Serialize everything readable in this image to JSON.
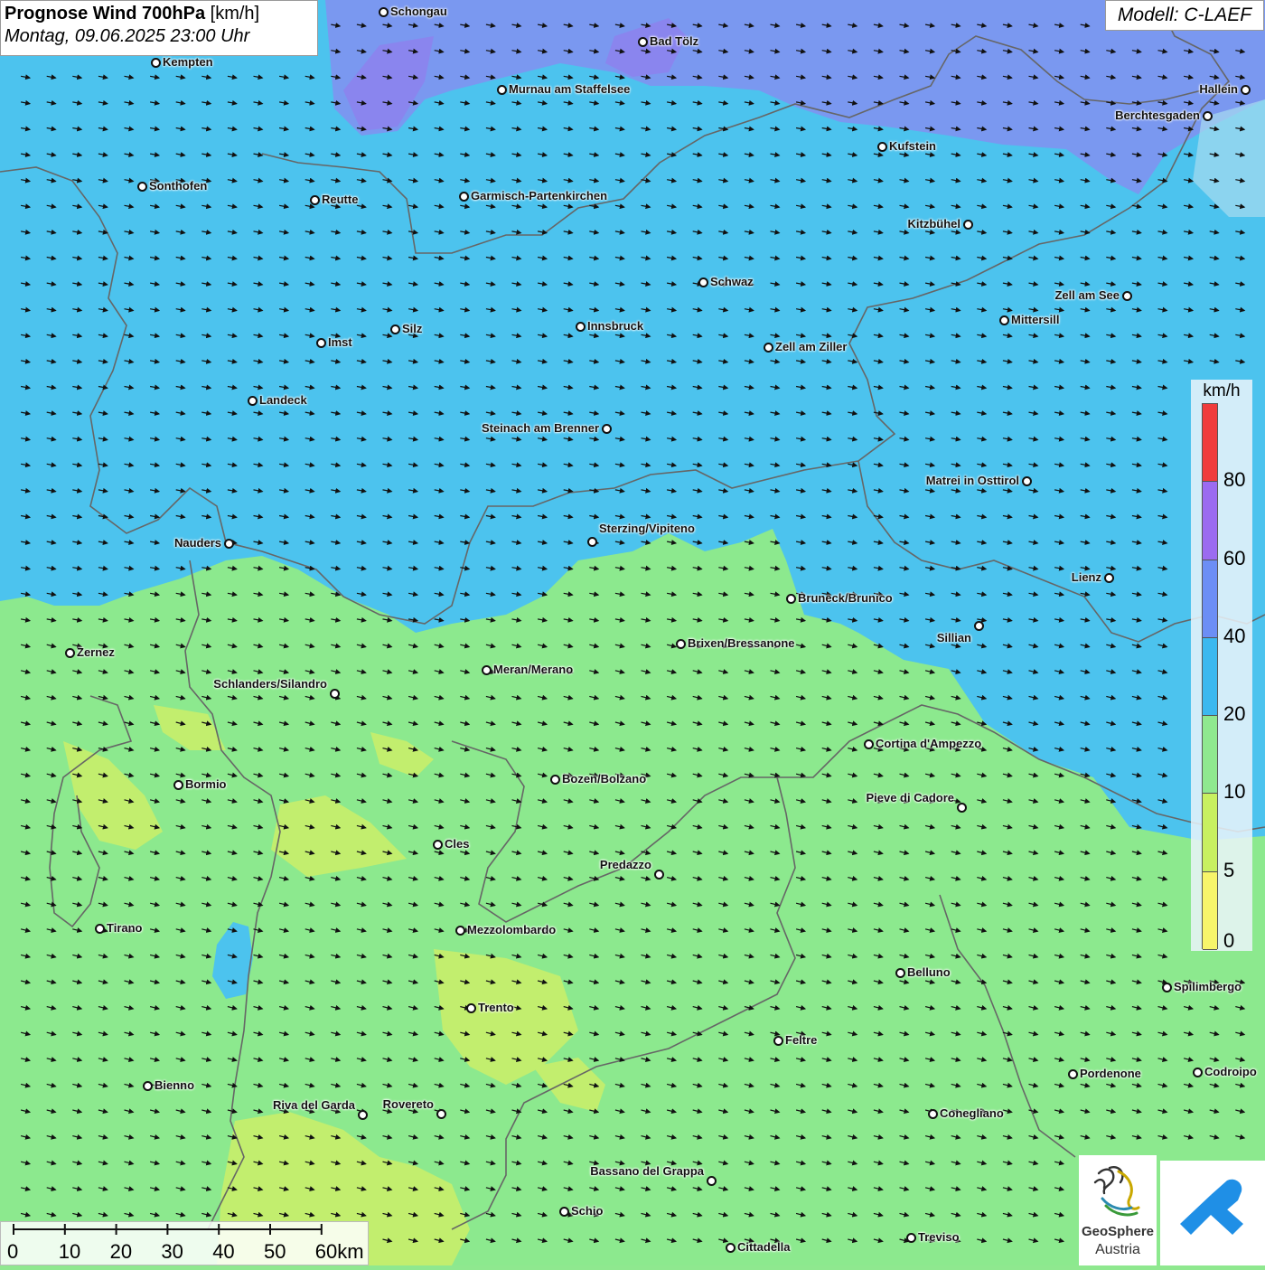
{
  "title": {
    "bold": "Prognose Wind 700hPa",
    "unit": " [km/h]",
    "date": "Montag, 09.06.2025 23:00 Uhr"
  },
  "model": "Modell: C-LAEF",
  "legend": {
    "unit": "km/h",
    "ticks": [
      "80",
      "60",
      "40",
      "20",
      "10",
      "5",
      "0"
    ],
    "colors": [
      "#f03c3c",
      "#9b6bf0",
      "#6c8ef5",
      "#3cb8ef",
      "#8fe88f",
      "#c8f060",
      "#f7f56a"
    ]
  },
  "scale": {
    "labels": [
      "0",
      "10",
      "20",
      "30",
      "40",
      "50",
      "60km"
    ]
  },
  "logo": {
    "line1": "GeoSphere",
    "line2": "Austria"
  },
  "wind_direction": "west-northwest to east-southeast",
  "cities": [
    {
      "name": "Schongau"
    },
    {
      "name": "Bad Tölz"
    },
    {
      "name": "Kempten"
    },
    {
      "name": "Murnau am Staffelsee"
    },
    {
      "name": "Hallein"
    },
    {
      "name": "Berchtesgaden"
    },
    {
      "name": "Kufstein"
    },
    {
      "name": "Sonthofen"
    },
    {
      "name": "Reutte"
    },
    {
      "name": "Garmisch-Partenkirchen"
    },
    {
      "name": "Kitzbühel"
    },
    {
      "name": "Schwaz"
    },
    {
      "name": "Zell am See"
    },
    {
      "name": "Mittersill"
    },
    {
      "name": "Innsbruck"
    },
    {
      "name": "Silz"
    },
    {
      "name": "Imst"
    },
    {
      "name": "Zell am Ziller"
    },
    {
      "name": "Landeck"
    },
    {
      "name": "Steinach am Brenner"
    },
    {
      "name": "Matrei in Osttirol"
    },
    {
      "name": "Nauders"
    },
    {
      "name": "Sterzing/Vipiteno"
    },
    {
      "name": "Lienz"
    },
    {
      "name": "Bruneck/Brunico"
    },
    {
      "name": "Sillian"
    },
    {
      "name": "Zernez"
    },
    {
      "name": "Brixen/Bressanone"
    },
    {
      "name": "Meran/Merano"
    },
    {
      "name": "Schlanders/Silandro"
    },
    {
      "name": "Cortina d'Ampezzo"
    },
    {
      "name": "Bozen/Bolzano"
    },
    {
      "name": "Bormio"
    },
    {
      "name": "Pieve di Cadore"
    },
    {
      "name": "Cles"
    },
    {
      "name": "Predazzo"
    },
    {
      "name": "Tirano"
    },
    {
      "name": "Mezzolombardo"
    },
    {
      "name": "Belluno"
    },
    {
      "name": "Spilimbergo"
    },
    {
      "name": "Trento"
    },
    {
      "name": "Feltre"
    },
    {
      "name": "Pordenone"
    },
    {
      "name": "Codroipo"
    },
    {
      "name": "Bienno"
    },
    {
      "name": "Riva del Garda"
    },
    {
      "name": "Rovereto"
    },
    {
      "name": "Conegliano"
    },
    {
      "name": "Bassano del Grappa"
    },
    {
      "name": "Schio"
    },
    {
      "name": "Treviso"
    },
    {
      "name": "Cittadella"
    }
  ]
}
